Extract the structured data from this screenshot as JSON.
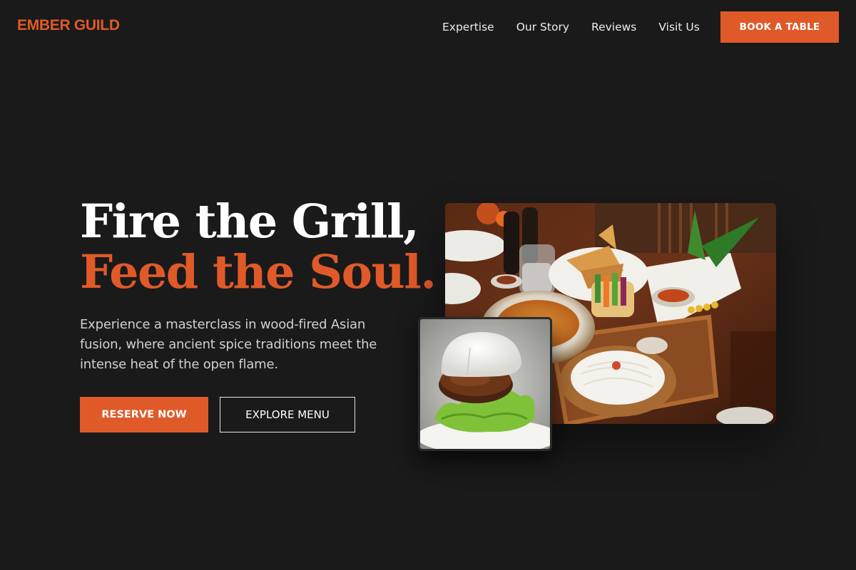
{
  "brand": {
    "name": "EMBER GUILD"
  },
  "nav": {
    "links": [
      "Expertise",
      "Our Story",
      "Reviews",
      "Visit Us"
    ],
    "cta_label": "BOOK A TABLE"
  },
  "hero": {
    "headline_line1": "Fire the Grill,",
    "headline_line2": "Feed the Soul.",
    "description": "Experience a masterclass in wood-fired Asian fusion, where ancient spice traditions meet the intense heat of the open flame.",
    "primary_label": "RESERVE NOW",
    "secondary_label": "EXPLORE MENU"
  },
  "images": {
    "main": "table spread with fusion dishes, noodle basket and drinks",
    "small": "steamed bao bun with grilled patty on lettuce"
  },
  "colors": {
    "accent": "#e05a29",
    "background": "#1a1a1a",
    "text": "#ffffff"
  }
}
